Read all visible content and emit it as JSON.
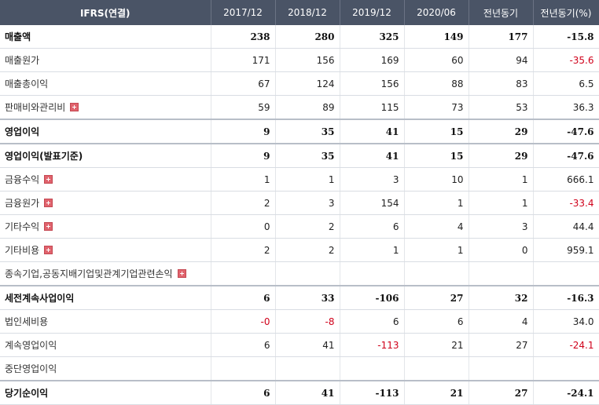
{
  "header": [
    "IFRS(연결)",
    "2017/12",
    "2018/12",
    "2019/12",
    "2020/06",
    "전년동기",
    "전년동기(%)"
  ],
  "rows": [
    {
      "label": "매출액",
      "values": [
        "238",
        "280",
        "325",
        "149",
        "177",
        "-15.8"
      ],
      "bold": true,
      "expand": false
    },
    {
      "label": "매출원가",
      "values": [
        "171",
        "156",
        "169",
        "60",
        "94",
        "-35.6"
      ],
      "bold": false,
      "expand": false
    },
    {
      "label": "매출총이익",
      "values": [
        "67",
        "124",
        "156",
        "88",
        "83",
        "6.5"
      ],
      "bold": false,
      "expand": false
    },
    {
      "label": "판매비와관리비",
      "values": [
        "59",
        "89",
        "115",
        "73",
        "53",
        "36.3"
      ],
      "bold": false,
      "expand": true
    },
    {
      "label": "영업이익",
      "values": [
        "9",
        "35",
        "41",
        "15",
        "29",
        "-47.6"
      ],
      "bold": true,
      "expand": false
    },
    {
      "label": "영업이익(발표기준)",
      "values": [
        "9",
        "35",
        "41",
        "15",
        "29",
        "-47.6"
      ],
      "bold": true,
      "expand": false
    },
    {
      "label": "금융수익",
      "values": [
        "1",
        "1",
        "3",
        "10",
        "1",
        "666.1"
      ],
      "bold": false,
      "expand": true
    },
    {
      "label": "금융원가",
      "values": [
        "2",
        "3",
        "154",
        "1",
        "1",
        "-33.4"
      ],
      "bold": false,
      "expand": true
    },
    {
      "label": "기타수익",
      "values": [
        "0",
        "2",
        "6",
        "4",
        "3",
        "44.4"
      ],
      "bold": false,
      "expand": true
    },
    {
      "label": "기타비용",
      "values": [
        "2",
        "2",
        "1",
        "1",
        "0",
        "959.1"
      ],
      "bold": false,
      "expand": true
    },
    {
      "label": "종속기업,공동지배기업및관계기업관련손익",
      "values": [
        "",
        "",
        "",
        "",
        "",
        ""
      ],
      "bold": false,
      "expand": true
    },
    {
      "label": "세전계속사업이익",
      "values": [
        "6",
        "33",
        "-106",
        "27",
        "32",
        "-16.3"
      ],
      "bold": true,
      "expand": false
    },
    {
      "label": "법인세비용",
      "values": [
        "-0",
        "-8",
        "6",
        "6",
        "4",
        "34.0"
      ],
      "bold": false,
      "expand": false
    },
    {
      "label": "계속영업이익",
      "values": [
        "6",
        "41",
        "-113",
        "21",
        "27",
        "-24.1"
      ],
      "bold": false,
      "expand": false
    },
    {
      "label": "중단영업이익",
      "values": [
        "",
        "",
        "",
        "",
        "",
        ""
      ],
      "bold": false,
      "expand": false
    },
    {
      "label": "당기순이익",
      "values": [
        "6",
        "41",
        "-113",
        "21",
        "27",
        "-24.1"
      ],
      "bold": true,
      "expand": false
    }
  ],
  "colors": {
    "header_bg": "#4a5466",
    "negative": "#d0021b",
    "expand_icon": "#e0636d"
  }
}
